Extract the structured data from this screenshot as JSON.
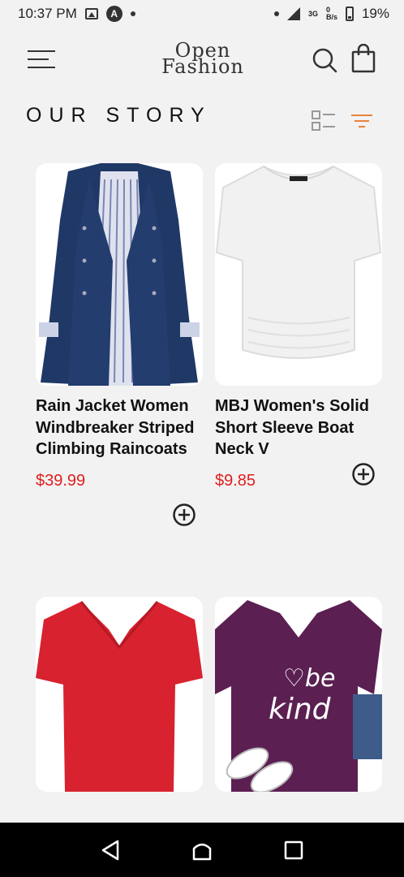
{
  "status_bar": {
    "time": "10:37 PM",
    "network": "3G",
    "speed": "0\nB/s",
    "battery": "19%"
  },
  "header": {
    "logo_line1": "Open",
    "logo_line2": "Fashion",
    "icons": [
      "menu-icon",
      "search-icon",
      "shopping-bag-icon"
    ]
  },
  "section": {
    "title": "OUR STORY",
    "icons": [
      "list-view-icon",
      "filter-icon"
    ],
    "accent_color": "#e8833a"
  },
  "products": [
    {
      "name": "Rain Jacket Women Windbreaker Striped Climbing Raincoats",
      "price": "$39.99"
    },
    {
      "name": "MBJ Women's Solid Short Sleeve Boat Neck V",
      "price": "$9.85"
    },
    {
      "name": "",
      "price": ""
    },
    {
      "name": "",
      "price": ""
    }
  ],
  "colors": {
    "price": "#e01e1e",
    "background": "#f2f2f2",
    "navbar": "#000000"
  },
  "navbar": {
    "icons": [
      "back-icon",
      "home-icon",
      "recents-icon"
    ]
  }
}
